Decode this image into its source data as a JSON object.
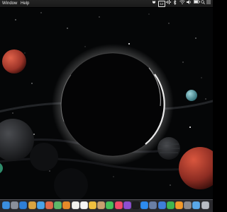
{
  "menubar": {
    "app_menus": [
      "Window",
      "Help"
    ],
    "status_icons": [
      "dropbox-icon",
      "calendar-icon",
      "audio-icon",
      "bluetooth-icon",
      "wifi-icon",
      "volume-icon",
      "battery-icon",
      "keyboard-icon",
      "spotlight-icon",
      "siri-icon",
      "control-icon"
    ],
    "calendar_day": "12"
  },
  "wallpaper": {
    "name": "space-planet-eclipse",
    "colors": {
      "background": "#050607",
      "red_planet": "#c24a3a",
      "cyan_planet": "#5aa0a8",
      "rim_light": "#ffffff"
    }
  },
  "dock": {
    "apps": [
      {
        "name": "finder-icon",
        "color": "#3b8fe0"
      },
      {
        "name": "launchpad-icon",
        "color": "#8a8f9a"
      },
      {
        "name": "safari-icon",
        "color": "#2f7fd6"
      },
      {
        "name": "photo-app-icon",
        "color": "#d9a441"
      },
      {
        "name": "mail-icon",
        "color": "#4aa3e8"
      },
      {
        "name": "puzzle-app-icon",
        "color": "#e06a4a"
      },
      {
        "name": "maps-icon",
        "color": "#5fb86a"
      },
      {
        "name": "books-icon",
        "color": "#e88a2a"
      },
      {
        "name": "notes-icon",
        "color": "#f2f2ee"
      },
      {
        "name": "calendar-app-icon",
        "color": "#f5f5f5"
      },
      {
        "name": "photos-icon",
        "color": "#f0c040"
      },
      {
        "name": "contacts-icon",
        "color": "#c8a070"
      },
      {
        "name": "facetime-icon",
        "color": "#46c25a"
      },
      {
        "name": "music-icon",
        "color": "#f24b6a"
      },
      {
        "name": "podcasts-icon",
        "color": "#8e4fd0"
      },
      {
        "name": "tv-icon",
        "color": "#1c1c1e"
      },
      {
        "name": "app-store-icon",
        "color": "#2d8cf0"
      },
      {
        "name": "preview-icon",
        "color": "#6a7fa6"
      },
      {
        "name": "keynote-icon",
        "color": "#3f7fd9"
      },
      {
        "name": "numbers-icon",
        "color": "#3fb650"
      },
      {
        "name": "pages-icon",
        "color": "#f39a2a"
      },
      {
        "name": "system-preferences-icon",
        "color": "#8c8c90"
      },
      {
        "name": "downloads-folder-icon",
        "color": "#5aa8e8"
      },
      {
        "name": "trash-icon",
        "color": "#b8bcc4"
      }
    ]
  }
}
